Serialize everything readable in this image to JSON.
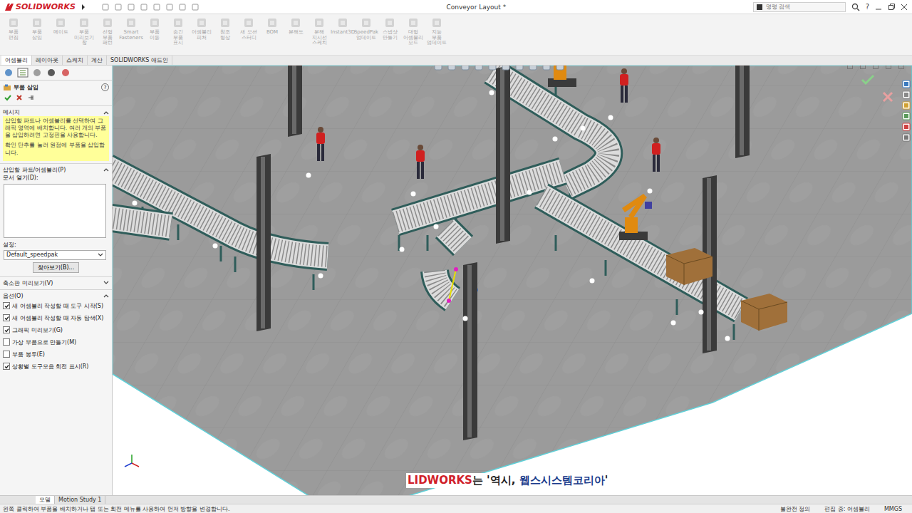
{
  "window": {
    "logo": "SOLIDWORKS",
    "title": "Conveyor Layout *",
    "search": {
      "placeholder": "명령 검색"
    },
    "help": "?"
  },
  "toolbar": [
    {
      "label": "부품 편집",
      "disabled": true
    },
    {
      "label": "부품 삽입",
      "disabled": true
    },
    {
      "label": "메이트",
      "disabled": true
    },
    {
      "label": "부품 미리보기 창",
      "disabled": true
    },
    {
      "label": "선형 부품 패턴",
      "disabled": true
    },
    {
      "label": "Smart Fasteners",
      "disabled": true
    },
    {
      "label": "부품 이동",
      "disabled": true
    },
    {
      "label": "숨긴 부품 표시",
      "disabled": true
    },
    {
      "label": "어셈블리 피처",
      "disabled": true
    },
    {
      "label": "참조 형상",
      "disabled": true
    },
    {
      "label": "새 모션 스터디",
      "disabled": true
    },
    {
      "label": "BOM",
      "disabled": true
    },
    {
      "label": "분해도",
      "disabled": true
    },
    {
      "label": "분해 지시선 스케치",
      "disabled": true
    },
    {
      "label": "Instant3D",
      "disabled": true
    },
    {
      "label": "SpeedPak 업데이트",
      "disabled": true
    },
    {
      "label": "스냅샷 만들기",
      "disabled": true
    },
    {
      "label": "대형 어셈블리 모드",
      "disabled": true
    },
    {
      "label": "지능 부품 업데이트",
      "disabled": true
    }
  ],
  "command_tabs": [
    {
      "label": "어셈블리",
      "selected": true
    },
    {
      "label": "레이아웃",
      "selected": false
    },
    {
      "label": "스케치",
      "selected": false
    },
    {
      "label": "계산",
      "selected": false
    },
    {
      "label": "SOLIDWORKS 애드인",
      "selected": false
    }
  ],
  "property_manager": {
    "title": "부품 삽입",
    "help": "?",
    "message": {
      "heading": "메시지",
      "paragraphs": [
        "삽입할 파트나 어셈블리를 선택하여 그래픽 영역에 배치합니다. 여러 개의 부품을 삽입하려면 고정핀을 사용합니다.",
        "확인 단추를 눌러 원점에 부품을 삽입합니다."
      ]
    },
    "part_section": {
      "heading": "삽입할 파트/어셈블리(P)",
      "open_documents_label": "문서 열기(D):",
      "config_label": "설정:",
      "config_value": "Default_speedpak",
      "browse_button": "찾아보기(B)..."
    },
    "thumbnail_section": {
      "heading": "축소판 미리보기(V)",
      "expanded": false
    },
    "options": {
      "heading": "옵션(O)",
      "expanded": true,
      "items": [
        {
          "label": "새 어셈블리 작성할 때 도구 시작(S)",
          "checked": true
        },
        {
          "label": "새 어셈블리 작성할 때 자동 탐색(X)",
          "checked": true
        },
        {
          "label": "그래픽 미리보기(G)",
          "checked": true
        },
        {
          "label": "가상 부품으로 만들기(M)",
          "checked": false
        },
        {
          "label": "부품 봉투(E)",
          "checked": false
        },
        {
          "label": "상황별 도구모음 회전 표시(R)",
          "checked": true
        }
      ]
    }
  },
  "viewport_caption": [
    {
      "text": "LIDWORKS",
      "color": "#d0202a"
    },
    {
      "text": "는 '역시, ",
      "color": "#222222"
    },
    {
      "text": "웹스시스템코리아",
      "color": "#1a3c8c"
    },
    {
      "text": "'",
      "color": "#222222"
    }
  ],
  "model_tabs": [
    {
      "label": "모델",
      "selected": true
    },
    {
      "label": "Motion Study 1",
      "selected": false
    }
  ],
  "status_bar": {
    "message": "왼쪽 클릭하여 부품을 배치하거나 탭 또는 회전 메뉴를 사용하여 먼저 방향을 변경합니다.",
    "fields": [
      "불완전 정의",
      "편집 중: 어셈블리",
      "MMGS"
    ]
  }
}
